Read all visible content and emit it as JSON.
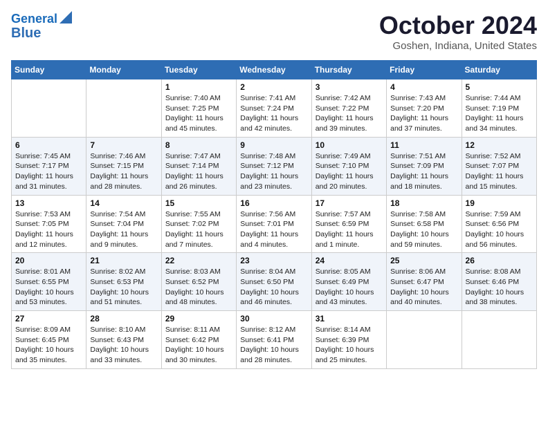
{
  "header": {
    "logo_line1": "General",
    "logo_line2": "Blue",
    "month_title": "October 2024",
    "location": "Goshen, Indiana, United States"
  },
  "weekdays": [
    "Sunday",
    "Monday",
    "Tuesday",
    "Wednesday",
    "Thursday",
    "Friday",
    "Saturday"
  ],
  "weeks": [
    [
      {
        "day": "",
        "sunrise": "",
        "sunset": "",
        "daylight": ""
      },
      {
        "day": "",
        "sunrise": "",
        "sunset": "",
        "daylight": ""
      },
      {
        "day": "1",
        "sunrise": "Sunrise: 7:40 AM",
        "sunset": "Sunset: 7:25 PM",
        "daylight": "Daylight: 11 hours and 45 minutes."
      },
      {
        "day": "2",
        "sunrise": "Sunrise: 7:41 AM",
        "sunset": "Sunset: 7:24 PM",
        "daylight": "Daylight: 11 hours and 42 minutes."
      },
      {
        "day": "3",
        "sunrise": "Sunrise: 7:42 AM",
        "sunset": "Sunset: 7:22 PM",
        "daylight": "Daylight: 11 hours and 39 minutes."
      },
      {
        "day": "4",
        "sunrise": "Sunrise: 7:43 AM",
        "sunset": "Sunset: 7:20 PM",
        "daylight": "Daylight: 11 hours and 37 minutes."
      },
      {
        "day": "5",
        "sunrise": "Sunrise: 7:44 AM",
        "sunset": "Sunset: 7:19 PM",
        "daylight": "Daylight: 11 hours and 34 minutes."
      }
    ],
    [
      {
        "day": "6",
        "sunrise": "Sunrise: 7:45 AM",
        "sunset": "Sunset: 7:17 PM",
        "daylight": "Daylight: 11 hours and 31 minutes."
      },
      {
        "day": "7",
        "sunrise": "Sunrise: 7:46 AM",
        "sunset": "Sunset: 7:15 PM",
        "daylight": "Daylight: 11 hours and 28 minutes."
      },
      {
        "day": "8",
        "sunrise": "Sunrise: 7:47 AM",
        "sunset": "Sunset: 7:14 PM",
        "daylight": "Daylight: 11 hours and 26 minutes."
      },
      {
        "day": "9",
        "sunrise": "Sunrise: 7:48 AM",
        "sunset": "Sunset: 7:12 PM",
        "daylight": "Daylight: 11 hours and 23 minutes."
      },
      {
        "day": "10",
        "sunrise": "Sunrise: 7:49 AM",
        "sunset": "Sunset: 7:10 PM",
        "daylight": "Daylight: 11 hours and 20 minutes."
      },
      {
        "day": "11",
        "sunrise": "Sunrise: 7:51 AM",
        "sunset": "Sunset: 7:09 PM",
        "daylight": "Daylight: 11 hours and 18 minutes."
      },
      {
        "day": "12",
        "sunrise": "Sunrise: 7:52 AM",
        "sunset": "Sunset: 7:07 PM",
        "daylight": "Daylight: 11 hours and 15 minutes."
      }
    ],
    [
      {
        "day": "13",
        "sunrise": "Sunrise: 7:53 AM",
        "sunset": "Sunset: 7:05 PM",
        "daylight": "Daylight: 11 hours and 12 minutes."
      },
      {
        "day": "14",
        "sunrise": "Sunrise: 7:54 AM",
        "sunset": "Sunset: 7:04 PM",
        "daylight": "Daylight: 11 hours and 9 minutes."
      },
      {
        "day": "15",
        "sunrise": "Sunrise: 7:55 AM",
        "sunset": "Sunset: 7:02 PM",
        "daylight": "Daylight: 11 hours and 7 minutes."
      },
      {
        "day": "16",
        "sunrise": "Sunrise: 7:56 AM",
        "sunset": "Sunset: 7:01 PM",
        "daylight": "Daylight: 11 hours and 4 minutes."
      },
      {
        "day": "17",
        "sunrise": "Sunrise: 7:57 AM",
        "sunset": "Sunset: 6:59 PM",
        "daylight": "Daylight: 11 hours and 1 minute."
      },
      {
        "day": "18",
        "sunrise": "Sunrise: 7:58 AM",
        "sunset": "Sunset: 6:58 PM",
        "daylight": "Daylight: 10 hours and 59 minutes."
      },
      {
        "day": "19",
        "sunrise": "Sunrise: 7:59 AM",
        "sunset": "Sunset: 6:56 PM",
        "daylight": "Daylight: 10 hours and 56 minutes."
      }
    ],
    [
      {
        "day": "20",
        "sunrise": "Sunrise: 8:01 AM",
        "sunset": "Sunset: 6:55 PM",
        "daylight": "Daylight: 10 hours and 53 minutes."
      },
      {
        "day": "21",
        "sunrise": "Sunrise: 8:02 AM",
        "sunset": "Sunset: 6:53 PM",
        "daylight": "Daylight: 10 hours and 51 minutes."
      },
      {
        "day": "22",
        "sunrise": "Sunrise: 8:03 AM",
        "sunset": "Sunset: 6:52 PM",
        "daylight": "Daylight: 10 hours and 48 minutes."
      },
      {
        "day": "23",
        "sunrise": "Sunrise: 8:04 AM",
        "sunset": "Sunset: 6:50 PM",
        "daylight": "Daylight: 10 hours and 46 minutes."
      },
      {
        "day": "24",
        "sunrise": "Sunrise: 8:05 AM",
        "sunset": "Sunset: 6:49 PM",
        "daylight": "Daylight: 10 hours and 43 minutes."
      },
      {
        "day": "25",
        "sunrise": "Sunrise: 8:06 AM",
        "sunset": "Sunset: 6:47 PM",
        "daylight": "Daylight: 10 hours and 40 minutes."
      },
      {
        "day": "26",
        "sunrise": "Sunrise: 8:08 AM",
        "sunset": "Sunset: 6:46 PM",
        "daylight": "Daylight: 10 hours and 38 minutes."
      }
    ],
    [
      {
        "day": "27",
        "sunrise": "Sunrise: 8:09 AM",
        "sunset": "Sunset: 6:45 PM",
        "daylight": "Daylight: 10 hours and 35 minutes."
      },
      {
        "day": "28",
        "sunrise": "Sunrise: 8:10 AM",
        "sunset": "Sunset: 6:43 PM",
        "daylight": "Daylight: 10 hours and 33 minutes."
      },
      {
        "day": "29",
        "sunrise": "Sunrise: 8:11 AM",
        "sunset": "Sunset: 6:42 PM",
        "daylight": "Daylight: 10 hours and 30 minutes."
      },
      {
        "day": "30",
        "sunrise": "Sunrise: 8:12 AM",
        "sunset": "Sunset: 6:41 PM",
        "daylight": "Daylight: 10 hours and 28 minutes."
      },
      {
        "day": "31",
        "sunrise": "Sunrise: 8:14 AM",
        "sunset": "Sunset: 6:39 PM",
        "daylight": "Daylight: 10 hours and 25 minutes."
      },
      {
        "day": "",
        "sunrise": "",
        "sunset": "",
        "daylight": ""
      },
      {
        "day": "",
        "sunrise": "",
        "sunset": "",
        "daylight": ""
      }
    ]
  ]
}
